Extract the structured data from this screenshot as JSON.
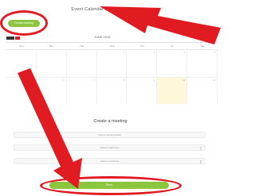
{
  "page": {
    "title": "Event Calendar for Video Conference"
  },
  "toolbar": {
    "create_label": "Create meeting"
  },
  "calendar": {
    "month": "JUNE 2016",
    "weekdays": [
      "Sun",
      "Mon",
      "Tue",
      "Wed",
      "Thu",
      "Fri",
      "Sat"
    ],
    "row1_numbers": [
      "",
      "",
      "",
      "1",
      "2",
      "3",
      "4"
    ],
    "row2_numbers": [
      "5",
      "6",
      "7",
      "8",
      "9",
      "10",
      "11"
    ]
  },
  "modal": {
    "title": "Create a meeting",
    "field1_placeholder": "Type a meeting name",
    "field2_placeholder": "Select a start time",
    "field3_placeholder": "Select a end time",
    "save_label": "Save"
  },
  "annotations": {
    "color": "#e01b22"
  },
  "colors": {
    "accent": "#8cc63f",
    "today": "#fff8d8"
  }
}
